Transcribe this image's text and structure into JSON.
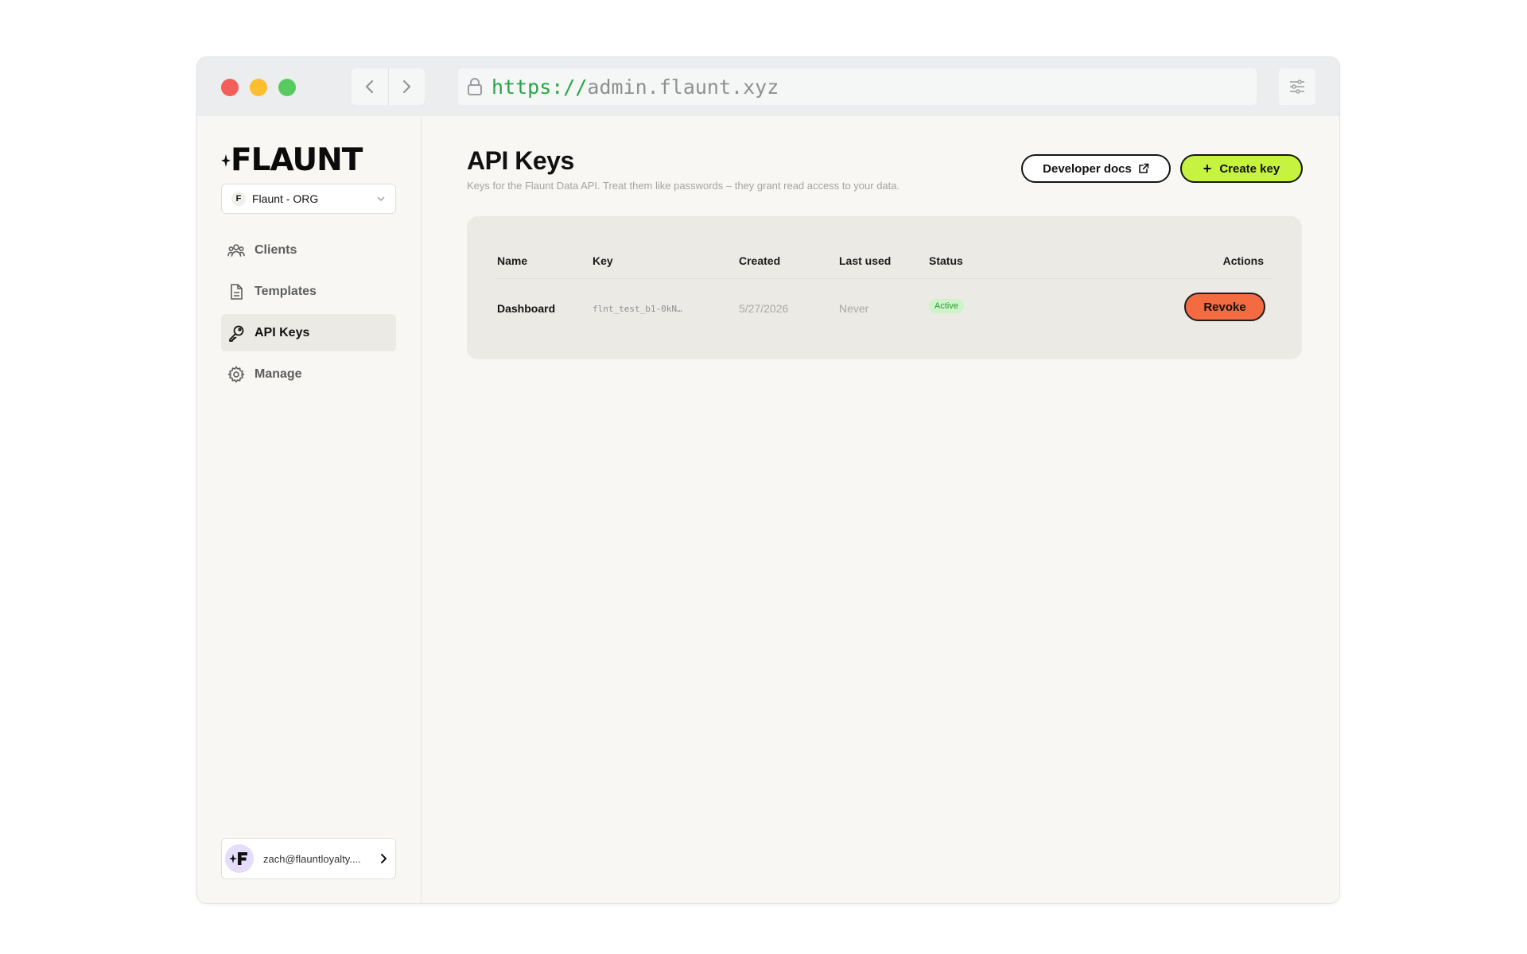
{
  "browser": {
    "url_scheme": "https://",
    "url_host": "admin.flaunt.xyz"
  },
  "sidebar": {
    "brand": "FLAUNT",
    "org": {
      "initial": "F",
      "name": "Flaunt  - ORG"
    },
    "items": [
      {
        "label": "Clients",
        "icon": "users-icon",
        "active": false
      },
      {
        "label": "Templates",
        "icon": "document-icon",
        "active": false
      },
      {
        "label": "API Keys",
        "icon": "key-icon",
        "active": true
      },
      {
        "label": "Manage",
        "icon": "gear-icon",
        "active": false
      }
    ],
    "account": {
      "email": "zach@flauntloyalty...."
    }
  },
  "page": {
    "title": "API Keys",
    "subtitle": "Keys for the Flaunt Data API. Treat them like passwords – they grant read access to your data.",
    "docs_button": "Developer docs",
    "create_button": "Create key"
  },
  "table": {
    "columns": [
      "Name",
      "Key",
      "Created",
      "Last used",
      "Status",
      "Actions"
    ],
    "rows": [
      {
        "name": "Dashboard",
        "key": "flnt_test_b1-0kN…",
        "created": "5/27/2026",
        "last_used": "Never",
        "status": "Active",
        "action": "Revoke"
      }
    ]
  },
  "colors": {
    "accent_green": "#c5f33f",
    "danger_orange": "#f46a41",
    "status_active_bg": "#cdf3c8",
    "status_active_text": "#2c9a3a"
  }
}
